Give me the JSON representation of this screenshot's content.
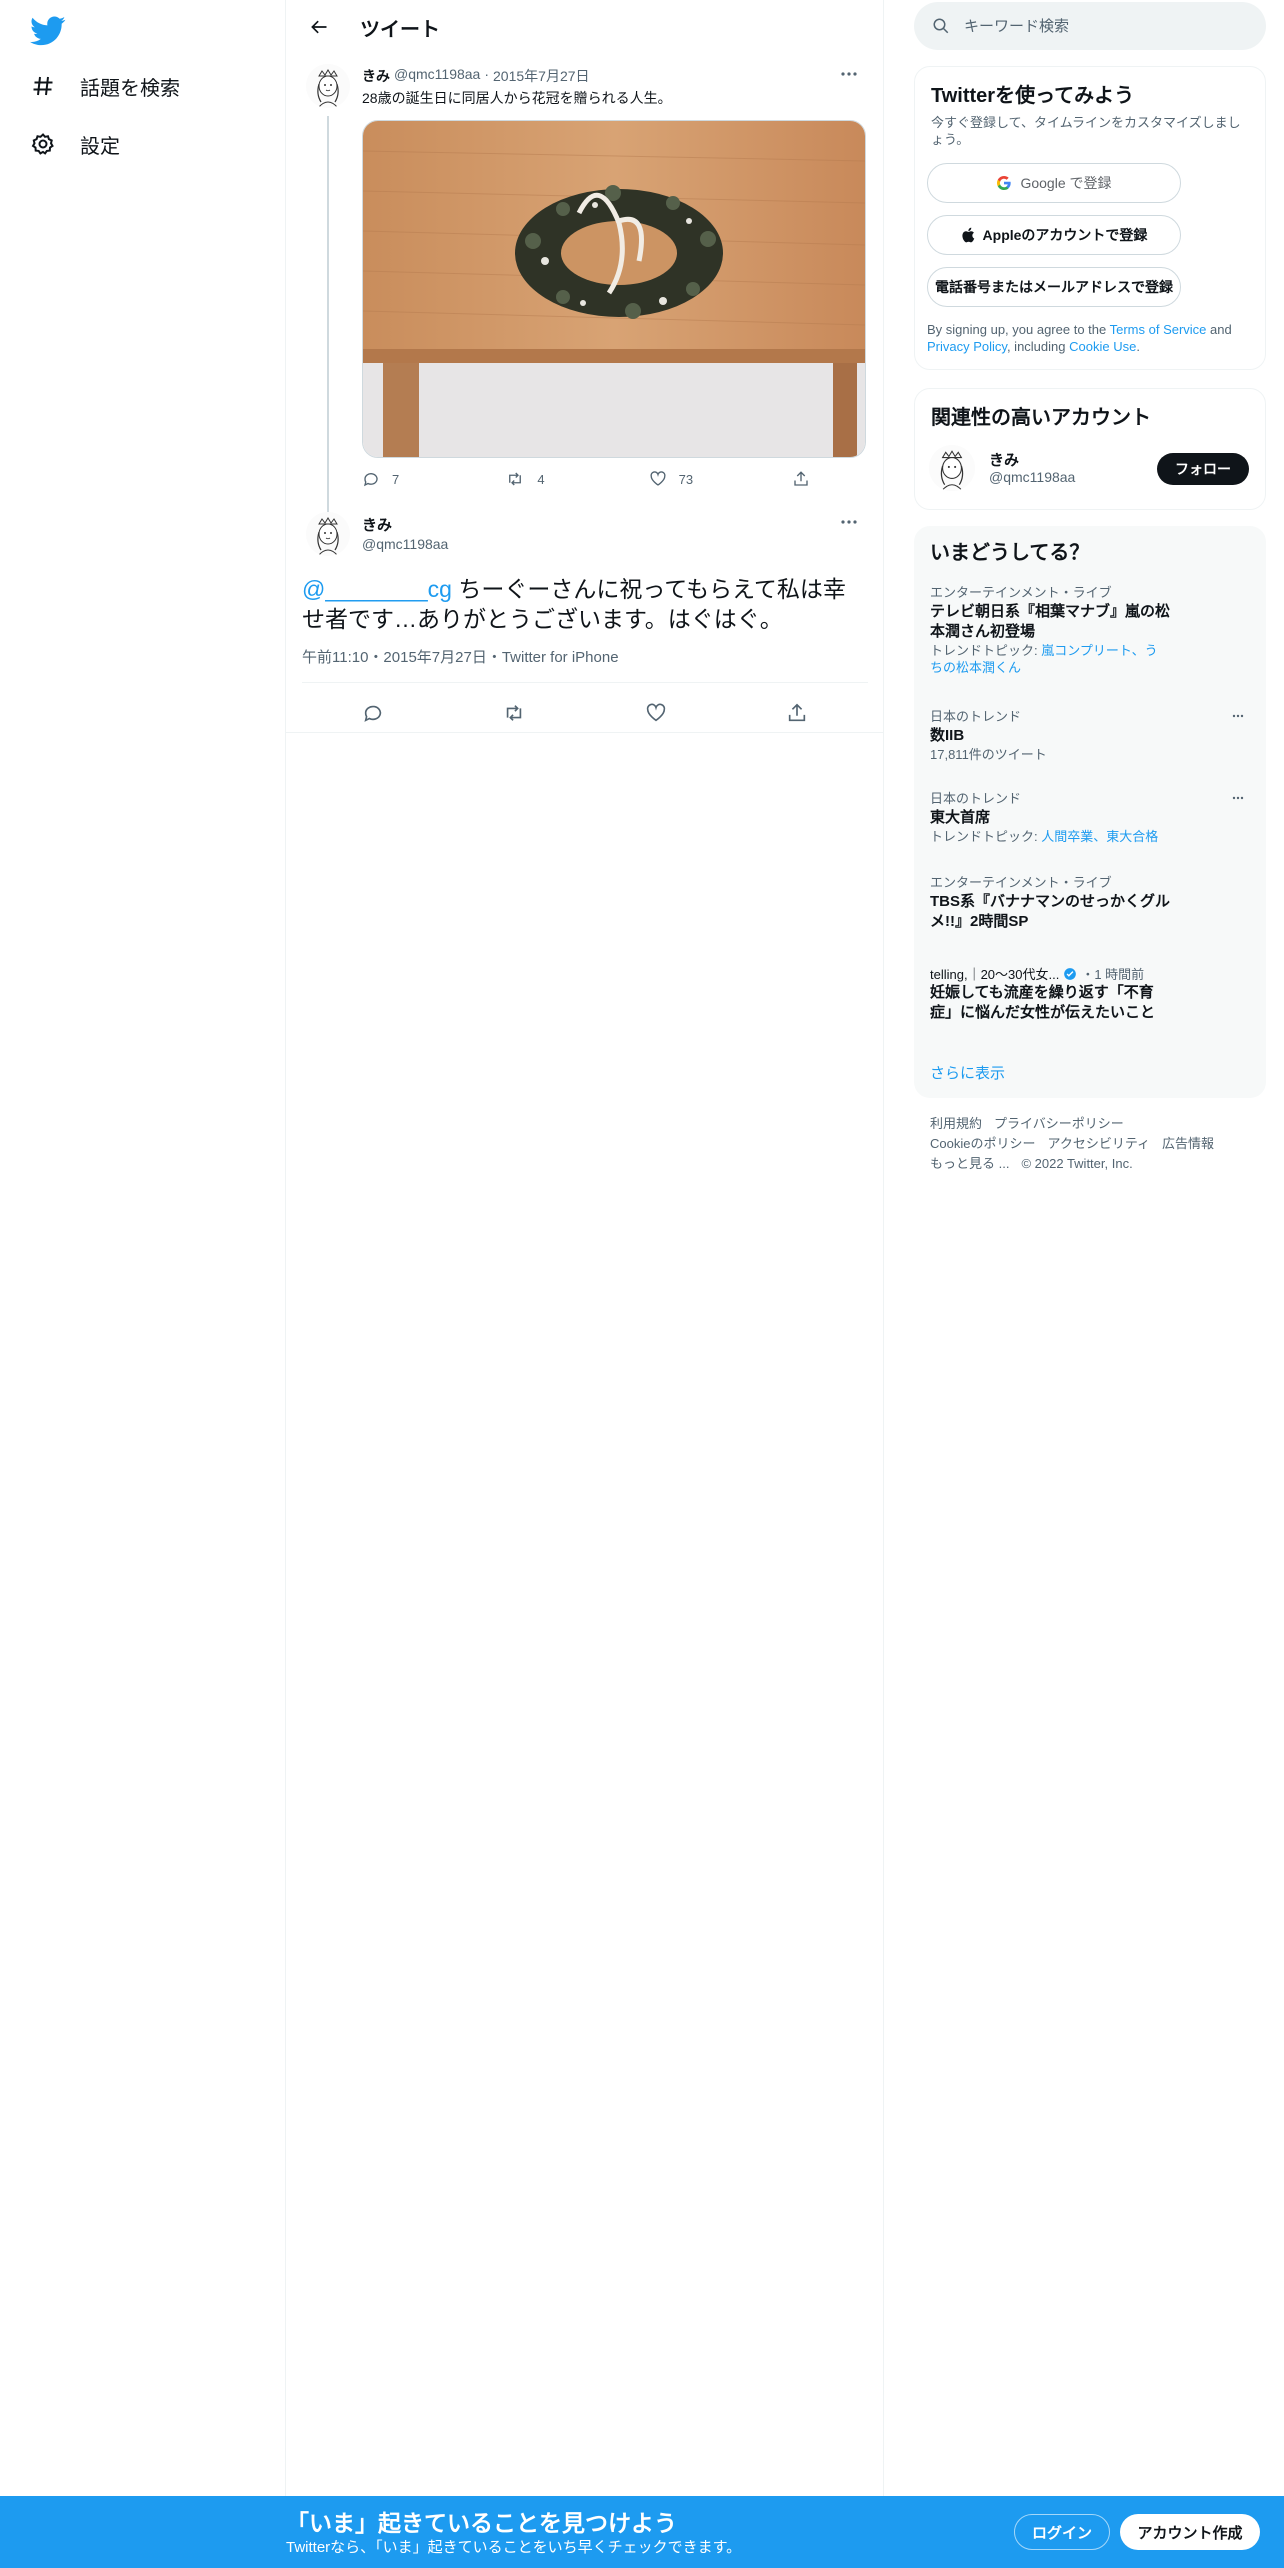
{
  "nav": {
    "explore_label": "話題を検索",
    "settings_label": "設定"
  },
  "header": {
    "title": "ツイート"
  },
  "tweet1": {
    "name": "きみ",
    "handle": "@qmc1198aa",
    "separator": "·",
    "date": "2015年7月27日",
    "text": "28歳の誕生日に同居人から花冠を贈られる人生。",
    "reply_count": "7",
    "retweet_count": "4",
    "like_count": "73"
  },
  "tweet2": {
    "name": "きみ",
    "handle": "@qmc1198aa",
    "mention": "@________cg",
    "text": " ちーぐーさんに祝ってもらえて私は幸せ者です…ありがとうございます。はぐはぐ。",
    "meta": "午前11:10・2015年7月27日・Twitter for iPhone"
  },
  "search": {
    "placeholder": "キーワード検索"
  },
  "signup": {
    "title": "Twitterを使ってみよう",
    "subtitle": "今すぐ登録して、タイムラインをカスタマイズしましょう。",
    "google_label": "Google で登録",
    "apple_label": "Appleのアカウントで登録",
    "phone_label": "電話番号またはメールアドレスで登録",
    "terms_prefix": "By signing up, you agree to the ",
    "terms_link": "Terms of Service",
    "terms_and": " and ",
    "privacy_link": "Privacy Policy",
    "terms_including": ", including ",
    "cookie_link": "Cookie Use",
    "terms_end": "."
  },
  "related": {
    "title": "関連性の高いアカウント",
    "name": "きみ",
    "handle": "@qmc1198aa",
    "follow_label": "フォロー"
  },
  "trends": {
    "title": "いまどうしてる？",
    "items": [
      {
        "category": "エンターテインメント・ライブ",
        "title": "テレビ朝日系『相葉マナブ』嵐の松本潤さん初登場",
        "sub_prefix": "トレンドトピック: ",
        "sub_links": "嵐コンプリート、うちの松本潤くん"
      },
      {
        "category": "日本のトレンド",
        "title": "数IIB",
        "sub": "17,811件のツイート"
      },
      {
        "category": "日本のトレンド",
        "title": "東大首席",
        "sub_prefix": "トレンドトピック: ",
        "sub_links": "人間卒業、東大合格"
      },
      {
        "category": "エンターテインメント・ライブ",
        "title": "TBS系『バナナマンのせっかくグルメ!!』2時間SP"
      },
      {
        "source": "telling,｜20～30代女...",
        "time": "・1 時間前",
        "title": "妊娠しても流産を繰り返す「不育症」に悩んだ女性が伝えたいこと"
      }
    ],
    "show_more": "さらに表示"
  },
  "footer": {
    "links": [
      "利用規約",
      "プライバシーポリシー",
      "Cookieのポリシー",
      "アクセシビリティ",
      "広告情報",
      "もっと見る ..."
    ],
    "copyright": "© 2022 Twitter, Inc."
  },
  "banner": {
    "title": "「いま」起きていることを見つけよう",
    "subtitle": "Twitterなら、「いま」起きていることをいち早くチェックできます。",
    "login_label": "ログイン",
    "signup_label": "アカウント作成"
  },
  "colors": {
    "brand": "#1d9bf0",
    "text": "#0f1419",
    "muted": "#536471"
  }
}
